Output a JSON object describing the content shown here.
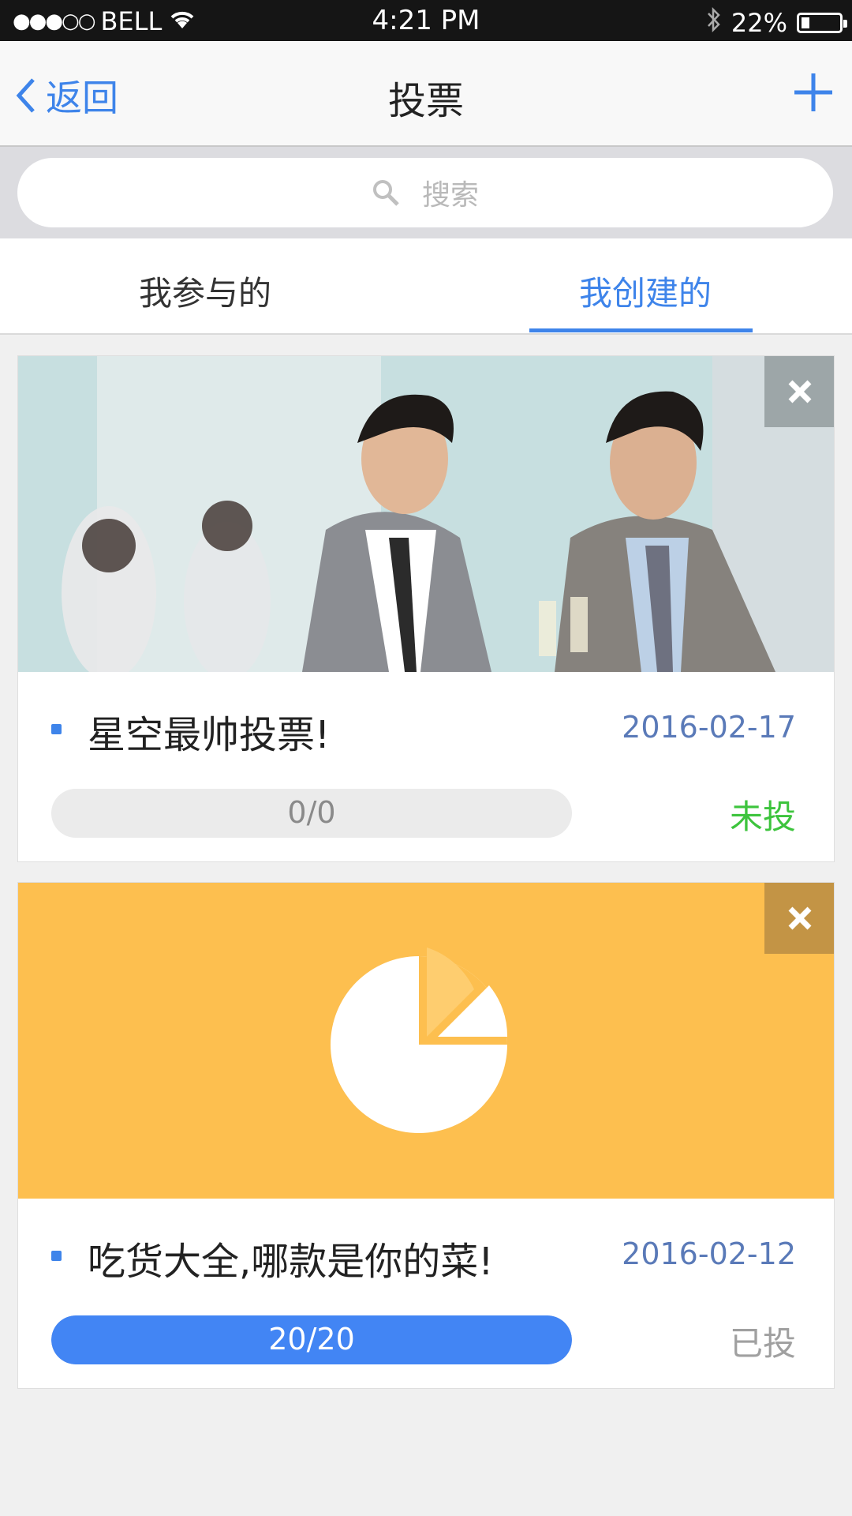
{
  "status_bar": {
    "carrier": "BELL",
    "time": "4:21 PM",
    "battery": "22%",
    "battery_level": 0.22
  },
  "nav": {
    "back_label": "返回",
    "title": "投票"
  },
  "search": {
    "placeholder": "搜索"
  },
  "tabs": [
    {
      "label": "我参与的",
      "active": false
    },
    {
      "label": "我创建的",
      "active": true
    }
  ],
  "polls": [
    {
      "title": "星空最帅投票!",
      "date": "2016-02-17",
      "progress_text": "0/0",
      "progress_fraction": 0,
      "status": "未投",
      "status_color": "#3dc43d"
    },
    {
      "title": "吃货大全,哪款是你的菜!",
      "date": "2016-02-12",
      "progress_text": "20/20",
      "progress_fraction": 1,
      "status": "已投",
      "status_color": "#a0a0a0"
    }
  ],
  "colors": {
    "accent": "#3e84ea",
    "banner_orange": "#fdbf4f"
  }
}
